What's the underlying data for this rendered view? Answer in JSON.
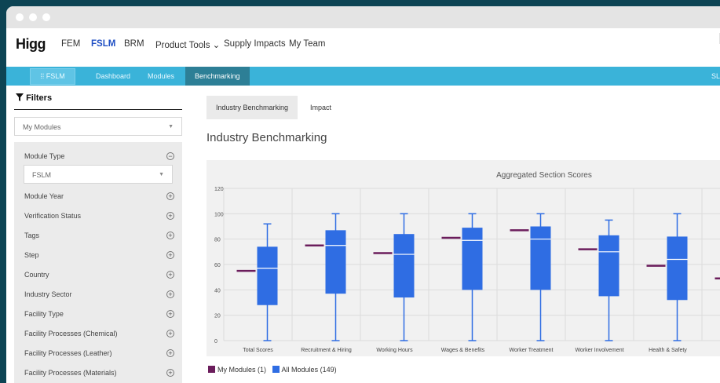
{
  "app": {
    "logo": "Higg",
    "nav": [
      {
        "label": "FEM",
        "active": false
      },
      {
        "label": "FSLM",
        "active": true
      },
      {
        "label": "BRM",
        "active": false
      },
      {
        "label": "Product Tools ⌄",
        "active": false
      },
      {
        "label": "Supply Impacts",
        "active": false
      },
      {
        "label": "My Team",
        "active": false
      }
    ]
  },
  "subnav": {
    "brand": "FSLM",
    "items": [
      "Dashboard",
      "Modules",
      "Benchmarking"
    ],
    "active": "Benchmarking",
    "right_text": "SL"
  },
  "sidebar": {
    "filters_label": "Filters",
    "modules_select": "My Modules",
    "module_type_label": "Module Type",
    "module_type_value": "FSLM",
    "filters": [
      "Module Year",
      "Verification Status",
      "Tags",
      "Step",
      "Country",
      "Industry Sector",
      "Facility Type",
      "Facility Processes (Chemical)",
      "Facility Processes (Leather)",
      "Facility Processes (Materials)"
    ]
  },
  "main": {
    "tabs": [
      "Industry Benchmarking",
      "Impact"
    ],
    "active_tab": "Industry Benchmarking",
    "page_title": "Industry Benchmarking"
  },
  "colors": {
    "my_modules": "#6b1d5c",
    "all_modules": "#2f6de3",
    "subnav": "#3ab3d9",
    "subnav_active": "#2d7f96",
    "nav_active": "#1f4fc4"
  },
  "chart_data": {
    "type": "box",
    "title": "Aggregated Section Scores",
    "ylim": [
      0,
      120
    ],
    "yticks": [
      0,
      20,
      40,
      60,
      80,
      100,
      120
    ],
    "grid": true,
    "legend_position": "bottom-left",
    "categories": [
      "Total Scores",
      "Recruitment & Hiring",
      "Working Hours",
      "Wages & Benefits",
      "Worker Treatment",
      "Worker Involvement",
      "Health & Safety"
    ],
    "series": [
      {
        "name": "My Modules (1)",
        "values": [
          55,
          75,
          69,
          81,
          87,
          72,
          59,
          49
        ]
      },
      {
        "name": "All Modules (149)",
        "boxes": [
          {
            "min": 0,
            "q1": 28,
            "median": 57,
            "q3": 74,
            "max": 92
          },
          {
            "min": 0,
            "q1": 37,
            "median": 75,
            "q3": 87,
            "max": 100
          },
          {
            "min": 0,
            "q1": 34,
            "median": 68,
            "q3": 84,
            "max": 100
          },
          {
            "min": 0,
            "q1": 40,
            "median": 79,
            "q3": 89,
            "max": 100
          },
          {
            "min": 0,
            "q1": 40,
            "median": 80,
            "q3": 90,
            "max": 100
          },
          {
            "min": 0,
            "q1": 35,
            "median": 70,
            "q3": 83,
            "max": 95
          },
          {
            "min": 0,
            "q1": 32,
            "median": 64,
            "q3": 82,
            "max": 100
          }
        ]
      }
    ]
  }
}
